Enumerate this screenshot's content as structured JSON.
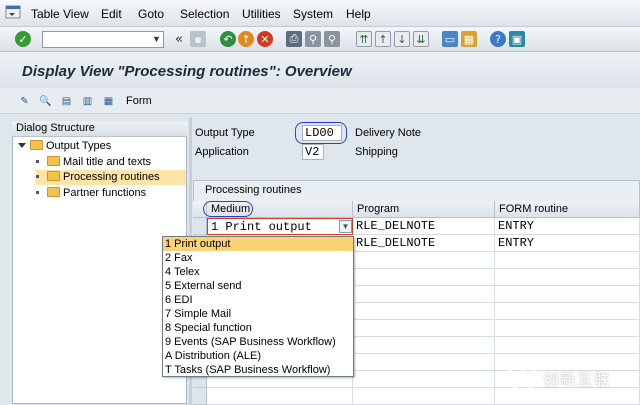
{
  "menubar": {
    "items": [
      "Table View",
      "Edit",
      "Goto",
      "Selection",
      "Utilities",
      "System",
      "Help"
    ],
    "underline": [
      "T",
      "E",
      "G",
      "S",
      "U",
      "S",
      "H"
    ]
  },
  "toolbar": {
    "command_value": "",
    "icons": [
      "enter-icon",
      "back-arrows-icon",
      "save-icon",
      "back-icon",
      "exit-icon",
      "cancel-icon",
      "print-icon",
      "find-icon",
      "find-next-icon",
      "first-page-icon",
      "prev-page-icon",
      "next-page-icon",
      "last-page-icon",
      "new-session-icon",
      "shortcut-icon",
      "help-icon",
      "customize-layout-icon"
    ]
  },
  "title": "Display View \"Processing routines\": Overview",
  "app_toolbar": {
    "form_label": "Form"
  },
  "dialog_structure": {
    "header": "Dialog Structure",
    "root": "Output Types",
    "children": [
      "Mail title and texts",
      "Processing routines",
      "Partner functions"
    ],
    "selected": "Processing routines"
  },
  "header_fields": {
    "output_type_label": "Output Type",
    "output_type_value": "LD00",
    "output_type_desc": "Delivery Note",
    "application_label": "Application",
    "application_value": "V2",
    "application_desc": "Shipping"
  },
  "table": {
    "title": "Processing routines",
    "columns": [
      "Medium",
      "Program",
      "FORM routine"
    ],
    "rows": [
      {
        "medium": "1 Print output",
        "program": "RLE_DELNOTE",
        "form": "ENTRY"
      },
      {
        "medium": "",
        "program": "RLE_DELNOTE",
        "form": "ENTRY"
      }
    ]
  },
  "medium_dropdown": {
    "options": [
      "1 Print output",
      "2 Fax",
      "4 Telex",
      "5 External send",
      "6 EDI",
      "7 Simple Mail",
      "8 Special function",
      "9 Events (SAP Business Workflow)",
      "A Distribution (ALE)",
      "T Tasks (SAP Business Workflow)"
    ],
    "highlighted_index": 0
  },
  "watermark": {
    "text": "创新互联"
  },
  "colors": {
    "accent_highlight": "#fbd377",
    "tree_selection": "#fce5a6",
    "annotation_oval": "#2b3fcf"
  }
}
